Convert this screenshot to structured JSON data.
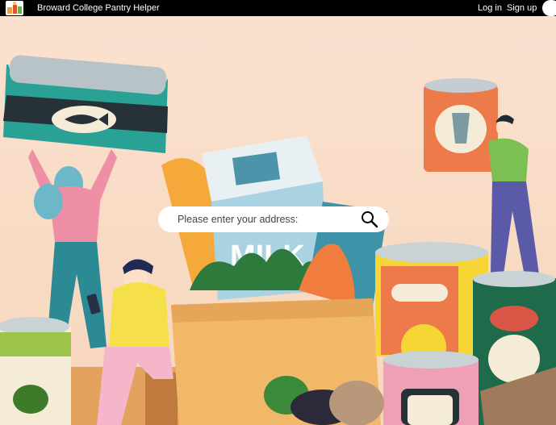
{
  "nav": {
    "brand": "Broward College Pantry Helper",
    "login": "Log in",
    "signup": "Sign up"
  },
  "hero": {
    "can_label_milk": "MILK"
  },
  "search": {
    "placeholder": "Please enter your address:",
    "value": ""
  },
  "colors": {
    "navbar": "#000000",
    "background": "#f8dcc4"
  }
}
